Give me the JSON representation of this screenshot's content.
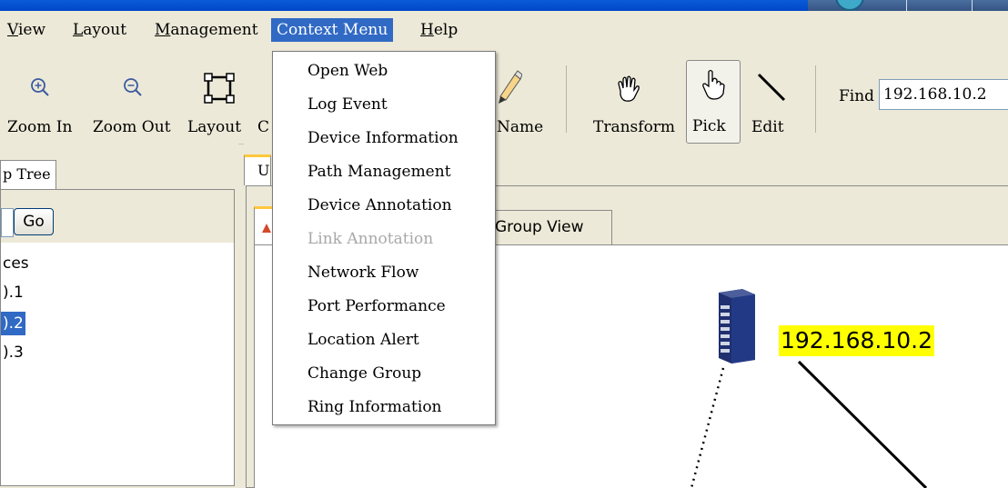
{
  "menubar": {
    "items": [
      {
        "label": "View",
        "mnemonic": "V",
        "rest": "iew"
      },
      {
        "label": "Layout",
        "mnemonic": "L",
        "rest": "ayout"
      },
      {
        "label": "Management",
        "mnemonic": "M",
        "rest": "anagement"
      },
      {
        "label": "Context Menu"
      },
      {
        "label": "Help",
        "mnemonic": "H",
        "rest": "elp"
      }
    ]
  },
  "toolbar": {
    "zoom_in": "Zoom In",
    "zoom_out": "Zoom Out",
    "layout": "Layout",
    "partial_c": "C",
    "name": "Name",
    "transform": "Transform",
    "pick": "Pick",
    "edit": "Edit",
    "find_label": "Find",
    "find_value": "192.168.10.2"
  },
  "context_menu": {
    "items": [
      {
        "label": "Open Web",
        "enabled": true
      },
      {
        "label": "Log Event",
        "enabled": true
      },
      {
        "label": "Device Information",
        "enabled": true
      },
      {
        "label": "Path Management",
        "enabled": true
      },
      {
        "label": "Device Annotation",
        "enabled": true
      },
      {
        "label": "Link Annotation",
        "enabled": false
      },
      {
        "label": "Network Flow",
        "enabled": true
      },
      {
        "label": "Port Performance",
        "enabled": true
      },
      {
        "label": "Location Alert",
        "enabled": true
      },
      {
        "label": "Change Group",
        "enabled": true
      },
      {
        "label": "Ring Information",
        "enabled": true
      }
    ]
  },
  "left_panel": {
    "tab_label": "p Tree",
    "go_button": "Go",
    "tree_items": [
      {
        "label": "ces",
        "selected": false
      },
      {
        "label": ").1",
        "selected": false
      },
      {
        "label": ").2",
        "selected": true
      },
      {
        "label": ").3",
        "selected": false
      }
    ]
  },
  "right_panel": {
    "tab_label": "U",
    "group_view_tab": "Group View",
    "device_label": "192.168.10.2"
  },
  "colors": {
    "selection": "#316ac5",
    "device_label_bg": "#ffff00",
    "tab_highlight": "#ffc83d"
  }
}
